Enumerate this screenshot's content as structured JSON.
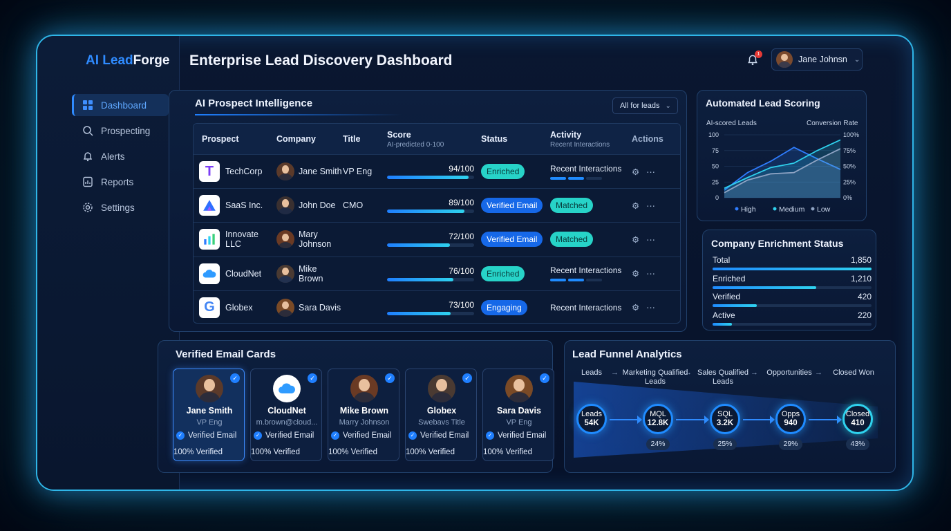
{
  "app": {
    "logo_a": "AI Lead",
    "logo_b": "Forge",
    "page_title": "Enterprise Lead Discovery Dashboard"
  },
  "notifications": {
    "count": "1"
  },
  "user": {
    "name": "Jane Johnsn"
  },
  "sidebar": {
    "items": [
      {
        "label": "Dashboard",
        "icon": "grid-icon",
        "active": true
      },
      {
        "label": "Prospecting",
        "icon": "search-icon"
      },
      {
        "label": "Alerts",
        "icon": "bell-icon"
      },
      {
        "label": "Reports",
        "icon": "report-icon"
      },
      {
        "label": "Settings",
        "icon": "gear-icon"
      }
    ]
  },
  "prospects": {
    "title": "AI Prospect Intelligence",
    "filter": "All for leads",
    "columns": {
      "prospect": "Prospect",
      "company": "Company",
      "title": "Title",
      "score": "Score",
      "score_sub": "AI-predicted 0-100",
      "status": "Status",
      "activity": "Activity",
      "activity_sub": "Recent Interactions",
      "actions": "Actions"
    },
    "rows": [
      {
        "org": "TechCorp",
        "person": "Jane Smith",
        "title": "VP Eng",
        "score": "94/100",
        "score_val": 94,
        "status": "Enriched",
        "status_style": "teal",
        "activity": "Recent Interactions",
        "activity_bars": 2
      },
      {
        "org": "SaaS Inc.",
        "person": "John Doe",
        "title": "CMO",
        "score": "89/100",
        "score_val": 89,
        "status": "Verified Email",
        "status_style": "blue",
        "activity": "Matched",
        "activity_bars": 0
      },
      {
        "org": "Innovate LLC",
        "person": "Mary Johnson",
        "title": "",
        "score": "72/100",
        "score_val": 72,
        "status": "Verified Email",
        "status_style": "blue",
        "activity": "Matched",
        "activity_bars": 0
      },
      {
        "org": "CloudNet",
        "person": "Mike Brown",
        "title": "",
        "score": "76/100",
        "score_val": 76,
        "status": "Enriched",
        "status_style": "teal",
        "activity": "Recent Interactions",
        "activity_bars": 2
      },
      {
        "org": "Globex",
        "person": "Sara Davis",
        "title": "",
        "score": "73/100",
        "score_val": 73,
        "status": "Engaging",
        "status_style": "blue",
        "activity": "Recent Interactions",
        "activity_bars": 0
      }
    ]
  },
  "scoring": {
    "title": "Automated Lead Scoring",
    "left_label": "AI-scored Leads",
    "right_label": "Conversion Rate",
    "left_ticks": [
      "100",
      "75",
      "50",
      "25",
      "0"
    ],
    "right_ticks": [
      "100%",
      "75%",
      "50%",
      "25%",
      "0%"
    ],
    "legend": [
      "High",
      "Medium",
      "Low"
    ],
    "colors": {
      "high": "#2f7dff",
      "medium": "#2fd2ee",
      "low": "#8fa4c4"
    }
  },
  "chart_data": {
    "type": "area",
    "ylim": [
      0,
      100
    ],
    "x": [
      0,
      1,
      2,
      3,
      4,
      5
    ],
    "series": [
      {
        "name": "High",
        "values": [
          12,
          40,
          58,
          80,
          62,
          45
        ]
      },
      {
        "name": "Medium",
        "values": [
          15,
          32,
          48,
          55,
          75,
          92
        ]
      },
      {
        "name": "Low",
        "values": [
          8,
          28,
          38,
          40,
          60,
          78
        ]
      }
    ],
    "y_left_label": "AI-scored Leads",
    "y_right_label": "Conversion Rate",
    "legend": "bottom"
  },
  "enrichment": {
    "title": "Company Enrichment Status",
    "rows": [
      {
        "label": "Total",
        "value": "1,850",
        "fill": 1.0
      },
      {
        "label": "Enriched",
        "value": "1,210",
        "fill": 0.65
      },
      {
        "label": "Verified",
        "value": "420",
        "fill": 0.28
      },
      {
        "label": "Active",
        "value": "220",
        "fill": 0.12
      }
    ]
  },
  "email_cards": {
    "title": "Verified Email Cards",
    "cards": [
      {
        "name": "Jane Smith",
        "sub": "VP Eng",
        "verified": "Verified Email",
        "pct": "100% Verified",
        "selected": true
      },
      {
        "name": "CloudNet",
        "sub": "m.brown@cloud...",
        "verified": "Verified Email",
        "pct": "100% Verified",
        "selected": false
      },
      {
        "name": "Mike Brown",
        "sub": "Marry Johnson",
        "verified": "Verified Email",
        "pct": "100% Verified",
        "selected": false
      },
      {
        "name": "Globex",
        "sub": "Swebavs Title",
        "verified": "Verified Email",
        "pct": "100% Verified",
        "selected": false
      },
      {
        "name": "Sara Davis",
        "sub": "VP Eng",
        "verified": "Verified Email",
        "pct": "100% Verified",
        "selected": false
      }
    ]
  },
  "funnel": {
    "title": "Lead Funnel Analytics",
    "stages": [
      {
        "label": "Leads",
        "node_label": "Leads",
        "node_value": "54K",
        "conversion": ""
      },
      {
        "label": "Marketing Qualified Leads",
        "node_label": "MQL",
        "node_value": "12.8K",
        "conversion": "24%"
      },
      {
        "label": "Sales Qualified Leads",
        "node_label": "SQL",
        "node_value": "3.2K",
        "conversion": "25%"
      },
      {
        "label": "Opportunities",
        "node_label": "Opps",
        "node_value": "940",
        "conversion": "29%"
      },
      {
        "label": "Closed Won",
        "node_label": "Closed",
        "node_value": "410",
        "conversion": "43%"
      }
    ]
  }
}
